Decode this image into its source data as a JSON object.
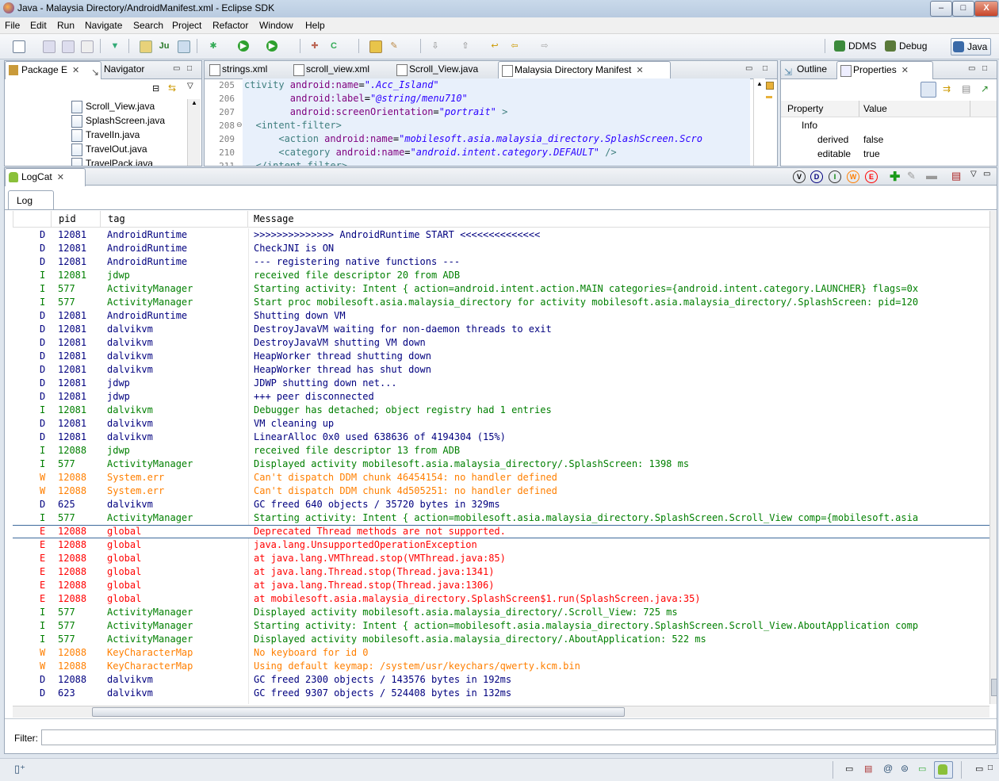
{
  "window": {
    "title": "Java - Malaysia Directory/AndroidManifest.xml - Eclipse SDK",
    "minimize": "–",
    "maximize": "□",
    "close": "X"
  },
  "menu": [
    "File",
    "Edit",
    "Run",
    "Navigate",
    "Search",
    "Project",
    "Refactor",
    "Window",
    "Help"
  ],
  "perspectives": [
    {
      "label": "DDMS",
      "icon": "ddms-icon",
      "color": "#3c8a3c"
    },
    {
      "label": "Debug",
      "icon": "debug-icon",
      "color": "#5a7a3a"
    },
    {
      "label": "Java",
      "icon": "java-icon",
      "color": "#3a6aa8"
    }
  ],
  "left_panel": {
    "tabs": [
      "Package E",
      "Navigator"
    ],
    "files": [
      "Scroll_View.java",
      "SplashScreen.java",
      "TravelIn.java",
      "TravelOut.java",
      "TravelPack.java"
    ]
  },
  "editor": {
    "tabs": [
      "strings.xml",
      "scroll_view.xml",
      "Scroll_View.java",
      "Malaysia Directory Manifest"
    ],
    "lines": [
      {
        "n": "205",
        "parts": [
          [
            "tg",
            "ctivity "
          ],
          [
            "at",
            "android:name"
          ],
          [
            "tx",
            "="
          ],
          [
            "av",
            "\".Acc_Island\""
          ]
        ]
      },
      {
        "n": "206",
        "parts": [
          [
            "tx",
            "        "
          ],
          [
            "at",
            "android:label"
          ],
          [
            "tx",
            "="
          ],
          [
            "av",
            "\"@string/menu710\""
          ]
        ]
      },
      {
        "n": "207",
        "parts": [
          [
            "tx",
            "        "
          ],
          [
            "at",
            "android:screenOrientation"
          ],
          [
            "tx",
            "="
          ],
          [
            "av",
            "\"portrait\""
          ],
          [
            "tg",
            " >"
          ]
        ]
      },
      {
        "n": "208",
        "parts": [
          [
            "tg",
            "  <intent-filter>"
          ]
        ]
      },
      {
        "n": "209",
        "parts": [
          [
            "tg",
            "      <action "
          ],
          [
            "at",
            "android:name"
          ],
          [
            "tx",
            "="
          ],
          [
            "av",
            "\"mobilesoft.asia.malaysia_directory.SplashScreen.Scro"
          ]
        ]
      },
      {
        "n": "210",
        "parts": [
          [
            "tg",
            "      <category "
          ],
          [
            "at",
            "android:name"
          ],
          [
            "tx",
            "="
          ],
          [
            "av",
            "\"android.intent.category.DEFAULT\""
          ],
          [
            "tg",
            " />"
          ]
        ]
      },
      {
        "n": "211",
        "parts": [
          [
            "tg",
            "  </intent-filter>"
          ]
        ]
      }
    ]
  },
  "right_panel": {
    "tabs": [
      "Outline",
      "Properties"
    ],
    "headers": [
      "Property",
      "Value"
    ],
    "rows": [
      {
        "property": "Info",
        "value": ""
      },
      {
        "property": "derived",
        "value": "false"
      },
      {
        "property": "editable",
        "value": "true"
      }
    ]
  },
  "logcat": {
    "title": "LogCat",
    "subtab": "Log",
    "columns": [
      "pid",
      "tag",
      "Message"
    ],
    "level_buttons": [
      "V",
      "D",
      "I",
      "W",
      "E"
    ],
    "filter_label": "Filter:",
    "filter_value": "",
    "rows": [
      {
        "lvl": "D",
        "pid": "12081",
        "tag": "AndroidRuntime",
        "msg": ">>>>>>>>>>>>>> AndroidRuntime START <<<<<<<<<<<<<<"
      },
      {
        "lvl": "D",
        "pid": "12081",
        "tag": "AndroidRuntime",
        "msg": "CheckJNI is ON"
      },
      {
        "lvl": "D",
        "pid": "12081",
        "tag": "AndroidRuntime",
        "msg": "--- registering native functions ---"
      },
      {
        "lvl": "I",
        "pid": "12081",
        "tag": "jdwp",
        "msg": "received file descriptor 20 from ADB"
      },
      {
        "lvl": "I",
        "pid": "577",
        "tag": "ActivityManager",
        "msg": "Starting activity: Intent { action=android.intent.action.MAIN categories={android.intent.category.LAUNCHER} flags=0x"
      },
      {
        "lvl": "I",
        "pid": "577",
        "tag": "ActivityManager",
        "msg": "Start proc mobilesoft.asia.malaysia_directory for activity mobilesoft.asia.malaysia_directory/.SplashScreen: pid=120"
      },
      {
        "lvl": "D",
        "pid": "12081",
        "tag": "AndroidRuntime",
        "msg": "Shutting down VM"
      },
      {
        "lvl": "D",
        "pid": "12081",
        "tag": "dalvikvm",
        "msg": "DestroyJavaVM waiting for non-daemon threads to exit"
      },
      {
        "lvl": "D",
        "pid": "12081",
        "tag": "dalvikvm",
        "msg": "DestroyJavaVM shutting VM down"
      },
      {
        "lvl": "D",
        "pid": "12081",
        "tag": "dalvikvm",
        "msg": "HeapWorker thread shutting down"
      },
      {
        "lvl": "D",
        "pid": "12081",
        "tag": "dalvikvm",
        "msg": "HeapWorker thread has shut down"
      },
      {
        "lvl": "D",
        "pid": "12081",
        "tag": "jdwp",
        "msg": "JDWP shutting down net..."
      },
      {
        "lvl": "D",
        "pid": "12081",
        "tag": "jdwp",
        "msg": "+++ peer disconnected"
      },
      {
        "lvl": "I",
        "pid": "12081",
        "tag": "dalvikvm",
        "msg": "Debugger has detached; object registry had 1 entries"
      },
      {
        "lvl": "D",
        "pid": "12081",
        "tag": "dalvikvm",
        "msg": "VM cleaning up"
      },
      {
        "lvl": "D",
        "pid": "12081",
        "tag": "dalvikvm",
        "msg": "LinearAlloc 0x0 used 638636 of 4194304 (15%)"
      },
      {
        "lvl": "I",
        "pid": "12088",
        "tag": "jdwp",
        "msg": "received file descriptor 13 from ADB"
      },
      {
        "lvl": "I",
        "pid": "577",
        "tag": "ActivityManager",
        "msg": "Displayed activity mobilesoft.asia.malaysia_directory/.SplashScreen: 1398 ms"
      },
      {
        "lvl": "W",
        "pid": "12088",
        "tag": "System.err",
        "msg": "Can't dispatch DDM chunk 46454154: no handler defined"
      },
      {
        "lvl": "W",
        "pid": "12088",
        "tag": "System.err",
        "msg": "Can't dispatch DDM chunk 4d505251: no handler defined"
      },
      {
        "lvl": "D",
        "pid": "625",
        "tag": "dalvikvm",
        "msg": "GC freed 640 objects / 35720 bytes in 329ms"
      },
      {
        "lvl": "I",
        "pid": "577",
        "tag": "ActivityManager",
        "msg": "Starting activity: Intent { action=mobilesoft.asia.malaysia_directory.SplashScreen.Scroll_View comp={mobilesoft.asia"
      },
      {
        "lvl": "E",
        "pid": "12088",
        "tag": "global",
        "msg": "Deprecated Thread methods are not supported."
      },
      {
        "lvl": "E",
        "pid": "12088",
        "tag": "global",
        "msg": "java.lang.UnsupportedOperationException"
      },
      {
        "lvl": "E",
        "pid": "12088",
        "tag": "global",
        "msg": "    at java.lang.VMThread.stop(VMThread.java:85)"
      },
      {
        "lvl": "E",
        "pid": "12088",
        "tag": "global",
        "msg": "    at java.lang.Thread.stop(Thread.java:1341)"
      },
      {
        "lvl": "E",
        "pid": "12088",
        "tag": "global",
        "msg": "    at java.lang.Thread.stop(Thread.java:1306)"
      },
      {
        "lvl": "E",
        "pid": "12088",
        "tag": "global",
        "msg": "    at mobilesoft.asia.malaysia_directory.SplashScreen$1.run(SplashScreen.java:35)"
      },
      {
        "lvl": "I",
        "pid": "577",
        "tag": "ActivityManager",
        "msg": "Displayed activity mobilesoft.asia.malaysia_directory/.Scroll_View: 725 ms"
      },
      {
        "lvl": "I",
        "pid": "577",
        "tag": "ActivityManager",
        "msg": "Starting activity: Intent { action=mobilesoft.asia.malaysia_directory.SplashScreen.Scroll_View.AboutApplication comp"
      },
      {
        "lvl": "I",
        "pid": "577",
        "tag": "ActivityManager",
        "msg": "Displayed activity mobilesoft.asia.malaysia_directory/.AboutApplication: 522 ms"
      },
      {
        "lvl": "W",
        "pid": "12088",
        "tag": "KeyCharacterMap",
        "msg": "No keyboard for id 0"
      },
      {
        "lvl": "W",
        "pid": "12088",
        "tag": "KeyCharacterMap",
        "msg": "Using default keymap: /system/usr/keychars/qwerty.kcm.bin"
      },
      {
        "lvl": "D",
        "pid": "12088",
        "tag": "dalvikvm",
        "msg": "GC freed 2300 objects / 143576 bytes in 192ms"
      },
      {
        "lvl": "D",
        "pid": "623",
        "tag": "dalvikvm",
        "msg": "GC freed 9307 objects / 524408 bytes in 132ms"
      }
    ],
    "selected_index": 22
  },
  "colors": {
    "debug": "#00007f",
    "info": "#007f00",
    "warn": "#ff7f00",
    "error": "#ff0000",
    "selection": "#3d6a9c"
  }
}
